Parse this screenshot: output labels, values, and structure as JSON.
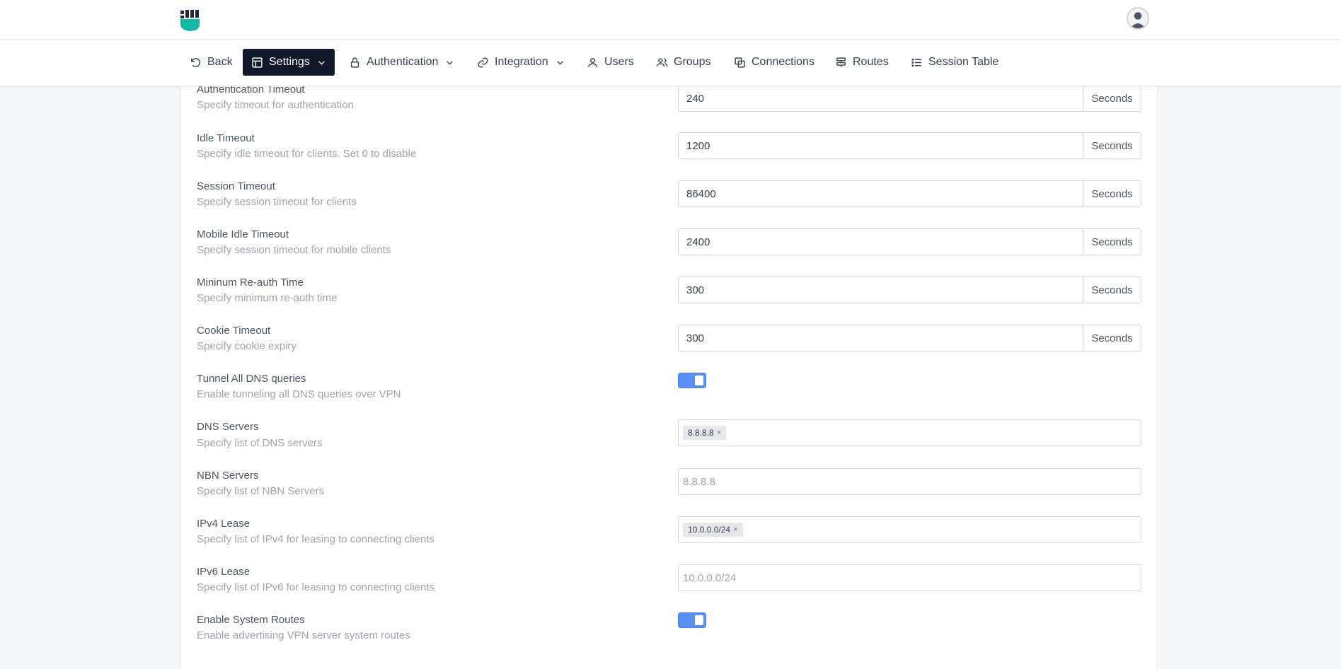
{
  "nav": {
    "back": "Back",
    "settings": "Settings",
    "authentication": "Authentication",
    "integration": "Integration",
    "users": "Users",
    "groups": "Groups",
    "connections": "Connections",
    "routes": "Routes",
    "session_table": "Session Table"
  },
  "settings": {
    "auth_timeout": {
      "label": "Authentication Timeout",
      "desc": "Specify timeout for authentication",
      "value": "240",
      "unit": "Seconds"
    },
    "idle_timeout": {
      "label": "Idle Timeout",
      "desc": "Specify idle timeout for clients. Set 0 to disable",
      "value": "1200",
      "unit": "Seconds"
    },
    "session_timeout": {
      "label": "Session Timeout",
      "desc": "Specify session timeout for clients",
      "value": "86400",
      "unit": "Seconds"
    },
    "mobile_idle_timeout": {
      "label": "Mobile Idle Timeout",
      "desc": "Specify session timeout for mobile clients",
      "value": "2400",
      "unit": "Seconds"
    },
    "min_reauth": {
      "label": "Mininum Re-auth Time",
      "desc": "Specify minimum re-auth time",
      "value": "300",
      "unit": "Seconds"
    },
    "cookie_timeout": {
      "label": "Cookie Timeout",
      "desc": "Specify cookie expiry",
      "value": "300",
      "unit": "Seconds"
    },
    "tunnel_dns": {
      "label": "Tunnel All DNS queries",
      "desc": "Enable tunneling all DNS queries over VPN",
      "enabled": true
    },
    "dns_servers": {
      "label": "DNS Servers",
      "desc": "Specify list of DNS servers",
      "tags": [
        "8.8.8.8"
      ]
    },
    "nbn_servers": {
      "label": "NBN Servers",
      "desc": "Specify list of NBN Servers",
      "placeholder": "8.8.8.8"
    },
    "ipv4_lease": {
      "label": "IPv4 Lease",
      "desc": "Specify list of IPv4 for leasing to connecting clients",
      "tags": [
        "10.0.0.0/24"
      ]
    },
    "ipv6_lease": {
      "label": "IPv6 Lease",
      "desc": "Specify list of IPv6 for leasing to connecting clients",
      "placeholder": "10.0.0.0/24"
    },
    "system_routes": {
      "label": "Enable System Routes",
      "desc": "Enable advertising VPN server system routes",
      "enabled": true
    }
  },
  "tag_remove_glyph": "×",
  "colors": {
    "active_nav_bg": "#111827",
    "toggle_on": "#5b8ff0",
    "logo_green": "#14b8a6",
    "logo_dark": "#1e293b"
  }
}
